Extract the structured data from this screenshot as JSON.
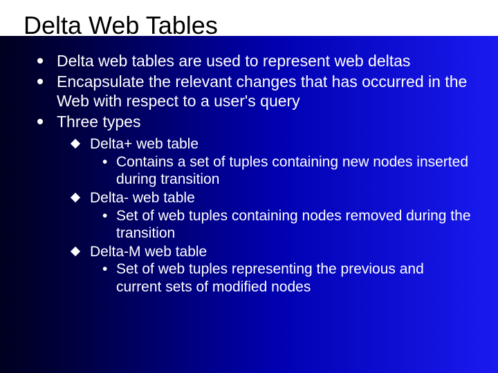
{
  "title": "Delta Web Tables",
  "bullets": {
    "b1": "Delta web tables are used to represent web deltas",
    "b2": "Encapsulate the relevant changes that has occurred in the Web with respect to a user's query",
    "b3": "Three types",
    "sub": {
      "s1": "Delta+ web table",
      "s1d": "Contains a set of tuples containing new nodes inserted during transition",
      "s2": "Delta- web table",
      "s2d": "Set of web tuples containing nodes removed during the transition",
      "s3": "Delta-M web table",
      "s3d": "Set of web tuples representing the previous and current sets of modified nodes"
    }
  }
}
